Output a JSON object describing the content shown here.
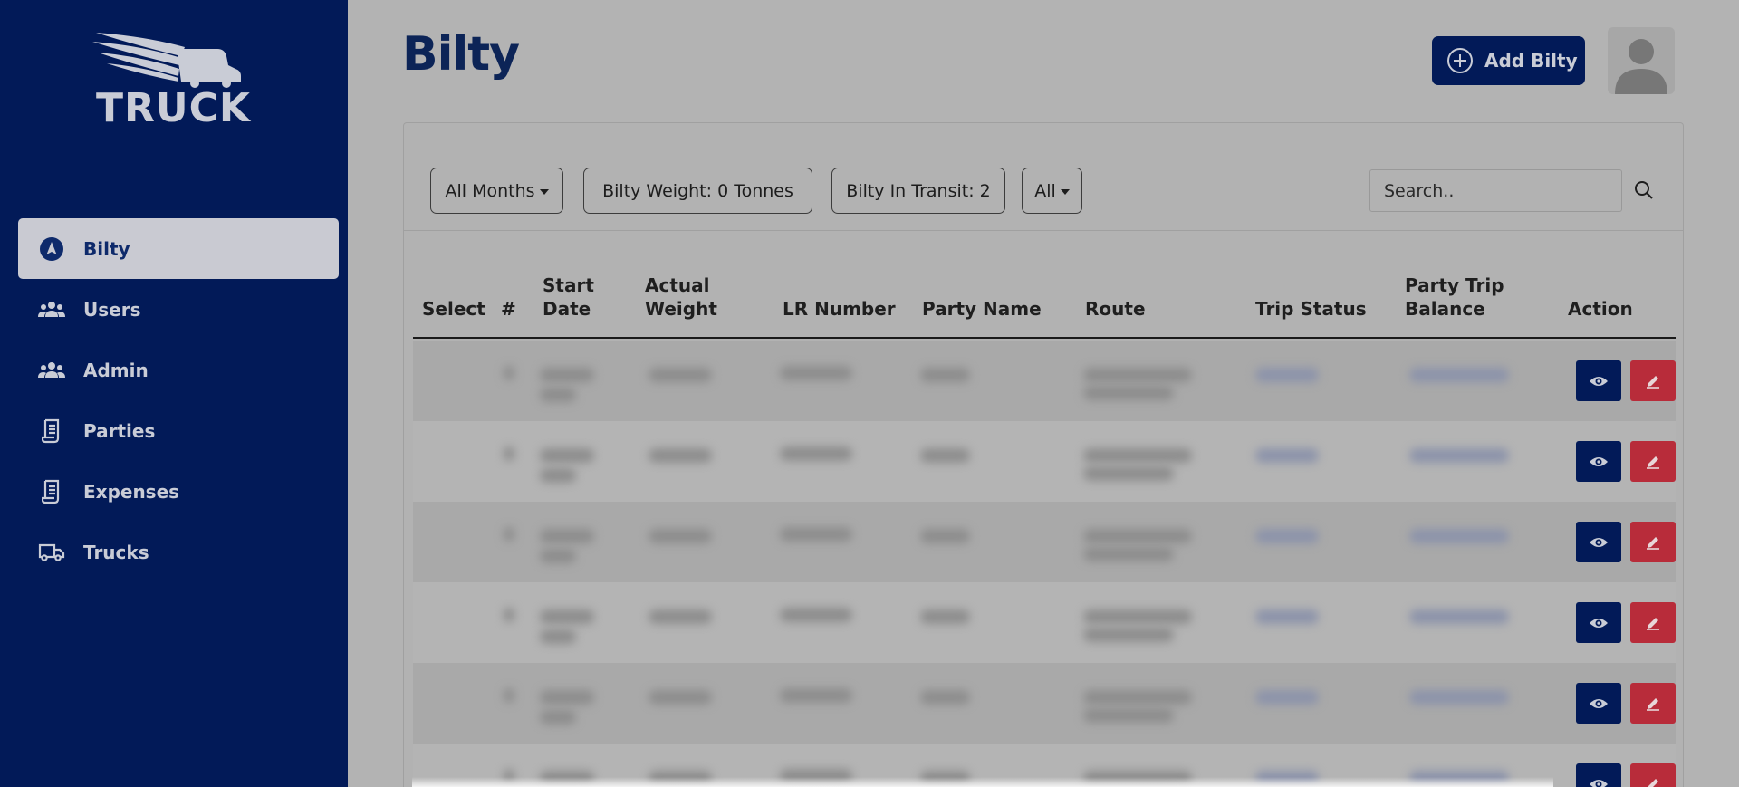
{
  "brand": {
    "logo_text": "TRUCK"
  },
  "sidebar": {
    "items": [
      {
        "label": "Bilty",
        "icon": "navigation-icon",
        "active": true
      },
      {
        "label": "Users",
        "icon": "users-icon",
        "active": false
      },
      {
        "label": "Admin",
        "icon": "users-icon",
        "active": false
      },
      {
        "label": "Parties",
        "icon": "document-icon",
        "active": false
      },
      {
        "label": "Expenses",
        "icon": "document-icon",
        "active": false
      },
      {
        "label": "Trucks",
        "icon": "truck-icon",
        "active": false
      }
    ]
  },
  "header": {
    "title": "Bilty",
    "add_button_label": "Add Bilty"
  },
  "filters": {
    "month": "All Months",
    "weight": "Bilty Weight: 0 Tonnes",
    "transit": "Bilty In Transit: 2",
    "status": "All",
    "search_placeholder": "Search.."
  },
  "table": {
    "headers": {
      "select": "Select",
      "num": "#",
      "start_date": "Start Date",
      "actual_weight": "Actual Weight",
      "lr_number": "LR Number",
      "party_name": "Party Name",
      "route": "Route",
      "trip_status": "Trip Status",
      "party_trip_balance": "Party Trip Balance",
      "action": "Action"
    },
    "row_count": 6
  },
  "colors": {
    "sidebar": "#021a58",
    "primary": "#021a58",
    "danger": "#b82c3a",
    "overlay_bg": "#b3b3b3"
  }
}
